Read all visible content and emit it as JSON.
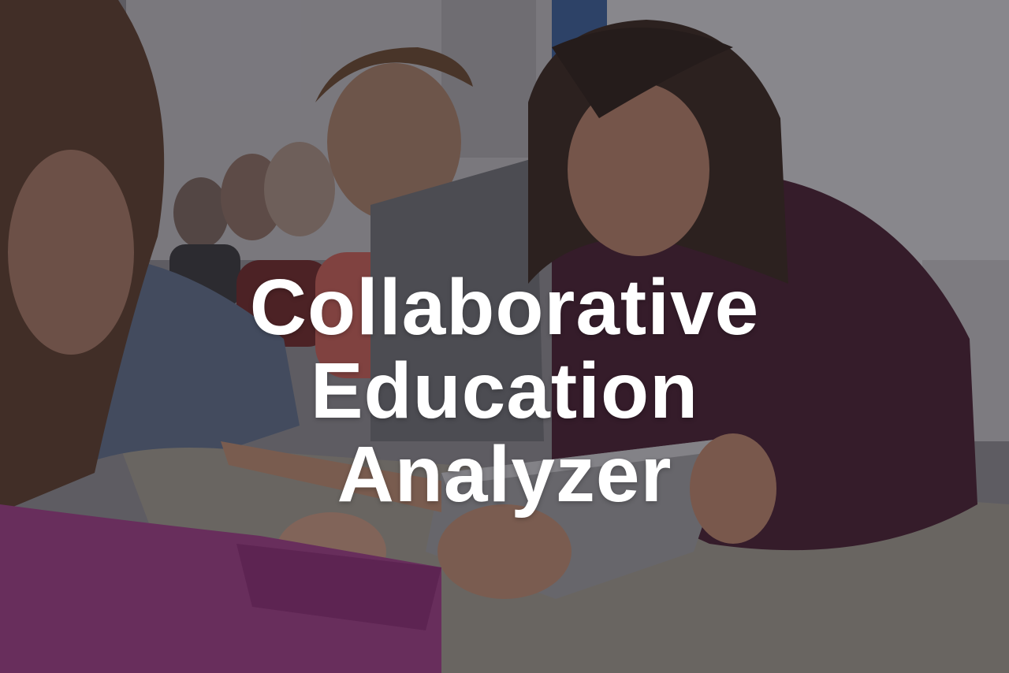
{
  "hero": {
    "title_lines": [
      "Collaborative",
      "Education",
      "Analyzer"
    ]
  },
  "photo": {
    "subject": "students-collaborating-with-tablet-in-classroom"
  },
  "colors": {
    "overlay": "#141218",
    "title": "#ffffff",
    "sweater_maroon": "#4a2336",
    "sweater_magenta": "#9b3f86",
    "tablet_gray": "#9a9a9f",
    "desk": "#b9b3a9",
    "wall": "#d9d9dd"
  }
}
